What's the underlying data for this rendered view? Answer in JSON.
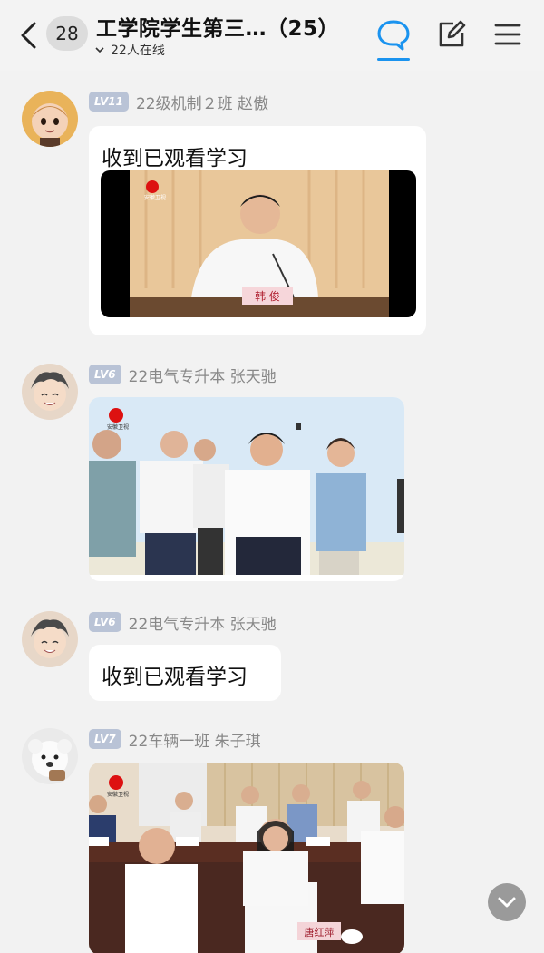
{
  "header": {
    "unread_count": "28",
    "title": "工学院学生第三…（25）",
    "online_text": "22人在线"
  },
  "messages": [
    {
      "level": "LV11",
      "sender": "22级机制２班 赵傲",
      "text": "收到已观看学习",
      "image": {
        "logo_text": "安徽卫视",
        "nameplate": "韩 俊"
      }
    },
    {
      "level": "LV6",
      "sender": "22电气专升本 张天驰",
      "image": {
        "logo_text": "安徽卫视"
      }
    },
    {
      "level": "LV6",
      "sender": "22电气专升本 张天驰",
      "text": "收到已观看学习"
    },
    {
      "level": "LV7",
      "sender": "22车辆一班 朱子琪",
      "image": {
        "logo_text": "安徽卫视",
        "nameplate": "唐红萍"
      }
    }
  ],
  "colors": {
    "accent": "#1a93ef",
    "level_badge": "#b9c3d6",
    "background": "#f2f2f2"
  },
  "icons": [
    "back-arrow-icon",
    "chevron-down-icon",
    "chat-bubble-icon",
    "edit-icon",
    "menu-icon",
    "scroll-down-icon"
  ]
}
